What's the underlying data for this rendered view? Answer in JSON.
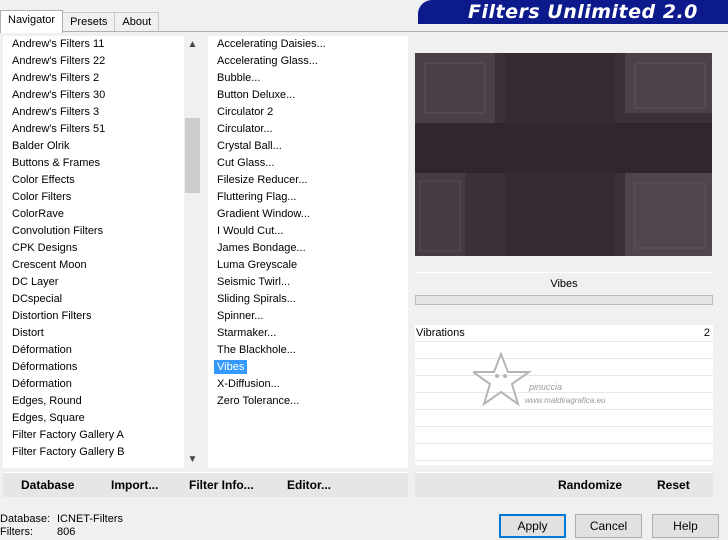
{
  "tabs": [
    "Navigator",
    "Presets",
    "About"
  ],
  "title": "Filters Unlimited 2.0",
  "categories": [
    "Andrew's Filters 11",
    "Andrew's Filters 22",
    "Andrew's Filters 2",
    "Andrew's Filters 30",
    "Andrew's Filters 3",
    "Andrew's Filters 51",
    "Balder Olrik",
    "Buttons & Frames",
    "Color Effects",
    "Color Filters",
    "ColorRave",
    "Convolution Filters",
    "CPK Designs",
    "Crescent Moon",
    "DC Layer",
    "DCspecial",
    "Distortion Filters",
    "Distort",
    "Déformation",
    "Déformations",
    "Déformation",
    "Edges, Round",
    "Edges, Square",
    "Filter Factory Gallery A",
    "Filter Factory Gallery B"
  ],
  "filters": [
    "Accelerating Daisies...",
    "Accelerating Glass...",
    "Bubble...",
    "Button Deluxe...",
    "Circulator 2",
    "Circulator...",
    "Crystal Ball...",
    "Cut Glass...",
    "Filesize Reducer...",
    "Fluttering Flag...",
    "Gradient Window...",
    "I Would Cut...",
    "James Bondage...",
    "Luma Greyscale",
    "Seismic Twirl...",
    "Sliding Spirals...",
    "Spinner...",
    "Starmaker...",
    "The Blackhole...",
    "Vibes",
    "X-Diffusion...",
    "Zero Tolerance..."
  ],
  "selected_filter_index": 19,
  "selected_filter": "Vibes",
  "params": [
    {
      "label": "Vibrations",
      "value": "2"
    }
  ],
  "watermark": {
    "line1": "pinuccia",
    "line2": "www.maldiragrafica.eu"
  },
  "left_bar": {
    "database": "Database",
    "import": "Import...",
    "filter_info": "Filter Info...",
    "editor": "Editor..."
  },
  "right_bar": {
    "randomize": "Randomize",
    "reset": "Reset"
  },
  "status": {
    "database_key": "Database:",
    "database_val": "ICNET-Filters",
    "filters_key": "Filters:",
    "filters_val": "806"
  },
  "buttons": {
    "apply": "Apply",
    "cancel": "Cancel",
    "help": "Help"
  },
  "colors": {
    "banner": "#0d1a8c",
    "selection": "#3399ff",
    "preview_bg": "#3b3037"
  }
}
